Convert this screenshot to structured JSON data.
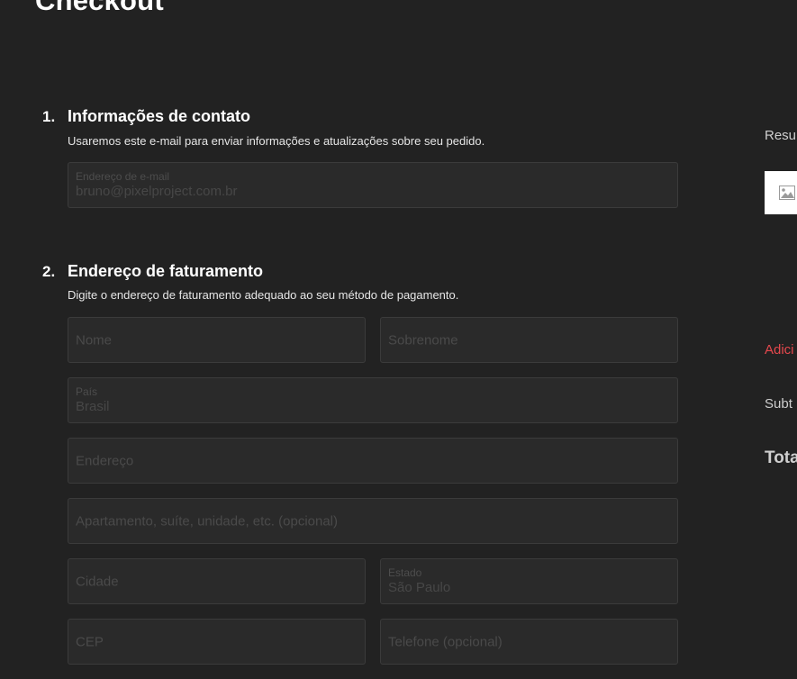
{
  "page": {
    "title": "Checkout"
  },
  "contact": {
    "number": "1.",
    "heading": "Informações de contato",
    "description": "Usaremos este e-mail para enviar informações e atualizações sobre seu pedido.",
    "email": {
      "label": "Endereço de e-mail",
      "value": "bruno@pixelproject.com.br"
    }
  },
  "billing": {
    "number": "2.",
    "heading": "Endereço de faturamento",
    "description": "Digite o endereço de faturamento adequado ao seu método de pagamento.",
    "first_name": {
      "placeholder": "Nome"
    },
    "last_name": {
      "placeholder": "Sobrenome"
    },
    "country": {
      "label": "País",
      "value": "Brasil"
    },
    "address": {
      "placeholder": "Endereço"
    },
    "address2": {
      "placeholder": "Apartamento, suíte, unidade, etc. (opcional)"
    },
    "city": {
      "placeholder": "Cidade"
    },
    "state": {
      "label": "Estado",
      "value": "São Paulo"
    },
    "postcode": {
      "placeholder": "CEP"
    },
    "phone": {
      "placeholder": "Telefone (opcional)"
    }
  },
  "sidebar": {
    "summary_label": "Resu",
    "product_thumbnail_icon": "image-placeholder-icon",
    "add_coupon_label": "Adici",
    "subtotal_label": "Subt",
    "total_label": "Tota"
  },
  "colors": {
    "background": "#222222",
    "field_background": "#2a2a2a",
    "field_border": "#3b3b3b",
    "link_red": "#e5484d"
  }
}
